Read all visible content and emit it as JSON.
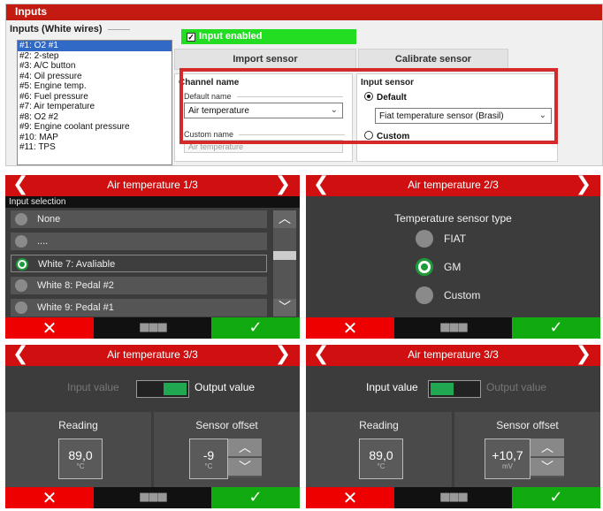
{
  "software": {
    "window_title": "Inputs",
    "inputs_header": "Inputs (White wires)",
    "input_list": [
      "#1: O2 #1",
      "#2: 2-step",
      "#3: A/C button",
      "#4: Oil pressure",
      "#5: Engine temp.",
      "#6: Fuel pressure",
      "#7: Air temperature",
      "#8: O2 #2",
      "#9: Engine coolant pressure",
      "#10: MAP",
      "#11: TPS"
    ],
    "selected_index": 0,
    "input_enabled_label": "Input enabled",
    "import_button": "Import sensor",
    "calibrate_button": "Calibrate sensor",
    "channel_name": {
      "title": "Channel name",
      "default_name_label": "Default name",
      "default_name_value": "Air temperature",
      "custom_name_label": "Custom name",
      "custom_name_placeholder": "Air temperature"
    },
    "input_sensor": {
      "title": "Input sensor",
      "default_label": "Default",
      "default_value": "Fiat temperature sensor (Brasil)",
      "custom_label": "Custom"
    }
  },
  "screens": {
    "s1": {
      "title": "Air temperature 1/3",
      "section": "Input selection",
      "options": [
        "None",
        "....",
        "White 7: Avaliable",
        "White 8: Pedal #2",
        "White 9: Pedal #1"
      ],
      "selected": 2
    },
    "s2": {
      "title": "Air temperature 2/3",
      "heading": "Temperature sensor type",
      "options": [
        "FIAT",
        "GM",
        "Custom"
      ],
      "selected": 1
    },
    "s3": {
      "title": "Air temperature 3/3",
      "input_value": "Input value",
      "output_value": "Output value",
      "reading_label": "Reading",
      "reading_value": "89,0",
      "reading_unit": "°C",
      "offset_label": "Sensor offset",
      "offset_value": "-9",
      "offset_unit": "°C"
    },
    "s4": {
      "title": "Air temperature 3/3",
      "input_value": "Input value",
      "output_value": "Output value",
      "reading_label": "Reading",
      "reading_value": "89,0",
      "reading_unit": "°C",
      "offset_label": "Sensor offset",
      "offset_value": "+10,7",
      "offset_unit": "mV"
    }
  },
  "glyphs": {
    "back": "❮",
    "forward": "❯",
    "cancel": "✕",
    "menu": "■■■",
    "confirm": "✓",
    "up": "︿",
    "down": "﹀"
  },
  "colors": {
    "header_red": "#d01010",
    "cancel_red": "#ee0000",
    "confirm_green": "#11aa11",
    "radio_green": "#1f9a3b",
    "enabled_green": "#22dd22",
    "highlight_red": "#d42a2a"
  }
}
